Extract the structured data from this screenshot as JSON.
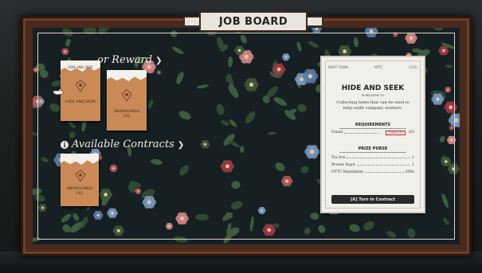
{
  "board_title": "JOB BOARD",
  "sections": {
    "reward": {
      "label": "or Reward"
    },
    "available": {
      "label": "Available Contracts"
    }
  },
  "cards": {
    "hide_and_seek": {
      "label": "HIDE AND SEEK",
      "tag": "HIDE AND SEEK"
    },
    "reward_unavailable": {
      "label": "UNAVAILABLE 101",
      "tag": ""
    },
    "contract_unavailable": {
      "label": "UNAVAILABLE 101",
      "tag": ""
    }
  },
  "document": {
    "header_left": "KNOT TOWN",
    "header_mid": "NTTC",
    "header_right": "(101)",
    "title": "HIDE AND SEEK",
    "subtitle": "IN RELATION TO",
    "description": "Collecting hides that can be used to help outfit company workers.",
    "requirements_title": "REQUIREMENTS",
    "requirement": {
      "label": "Found",
      "status": "COMPLETE",
      "value": "3/3"
    },
    "prize_title": "PRIZE PURSE",
    "prizes": [
      {
        "label": "Tin Ore",
        "value": "1"
      },
      {
        "label": "Bronze Ingot",
        "value": "1"
      },
      {
        "label": "NTTC Reputation",
        "value": "2000"
      }
    ],
    "turn_in_label": "[A] Turn In Contract"
  },
  "colors": {
    "card": "#c98a58",
    "paper": "#f1efe9",
    "frame": "#4a2a1d",
    "stamp": "#b03030"
  }
}
